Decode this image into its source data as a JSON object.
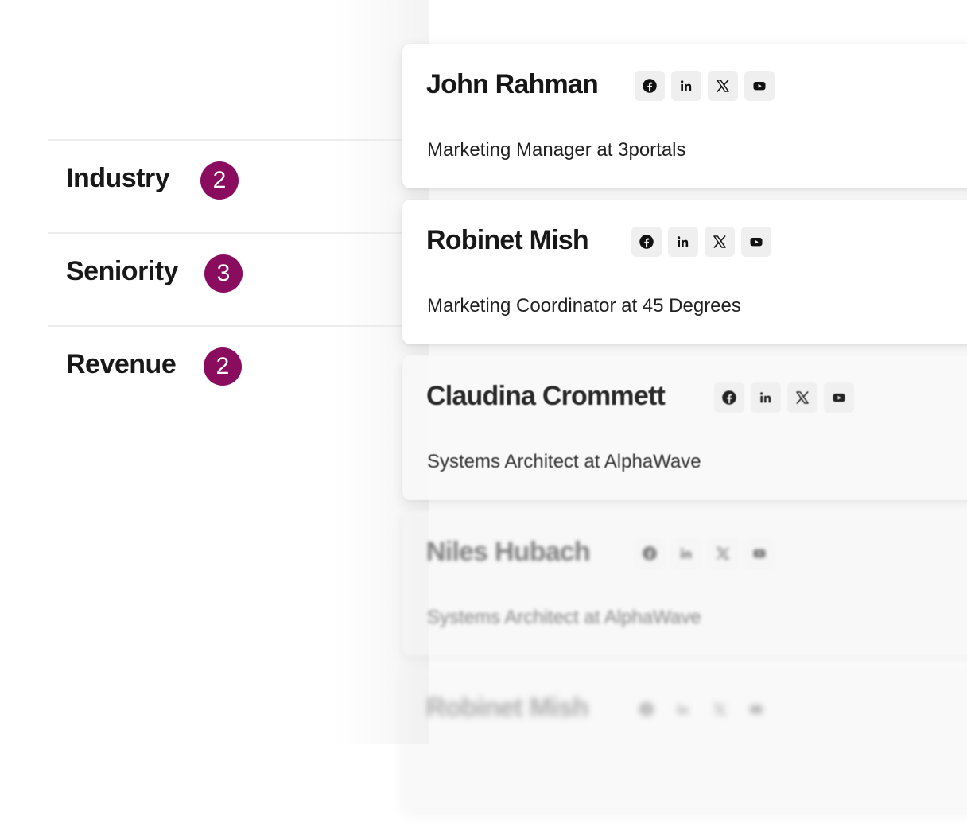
{
  "filters": [
    {
      "label": "Industry",
      "count": "2"
    },
    {
      "label": "Seniority",
      "count": "3"
    },
    {
      "label": "Revenue",
      "count": "2"
    }
  ],
  "contacts": [
    {
      "name": "John Rahman",
      "title": "Marketing Manager at 3portals"
    },
    {
      "name": "Robinet Mish",
      "title": "Marketing Coordinator at 45 Degrees"
    },
    {
      "name": "Claudina Crommett",
      "title": "Systems Architect at AlphaWave"
    },
    {
      "name": "Niles Hubach",
      "title": "Systems Architect at AlphaWave"
    },
    {
      "name": "Robinet Mish",
      "title": ""
    }
  ],
  "social_icons": [
    "facebook-icon",
    "linkedin-icon",
    "x-icon",
    "youtube-icon"
  ],
  "colors": {
    "badge": "#8a0c5e",
    "icon_bg": "#efefef",
    "text": "#171717"
  }
}
